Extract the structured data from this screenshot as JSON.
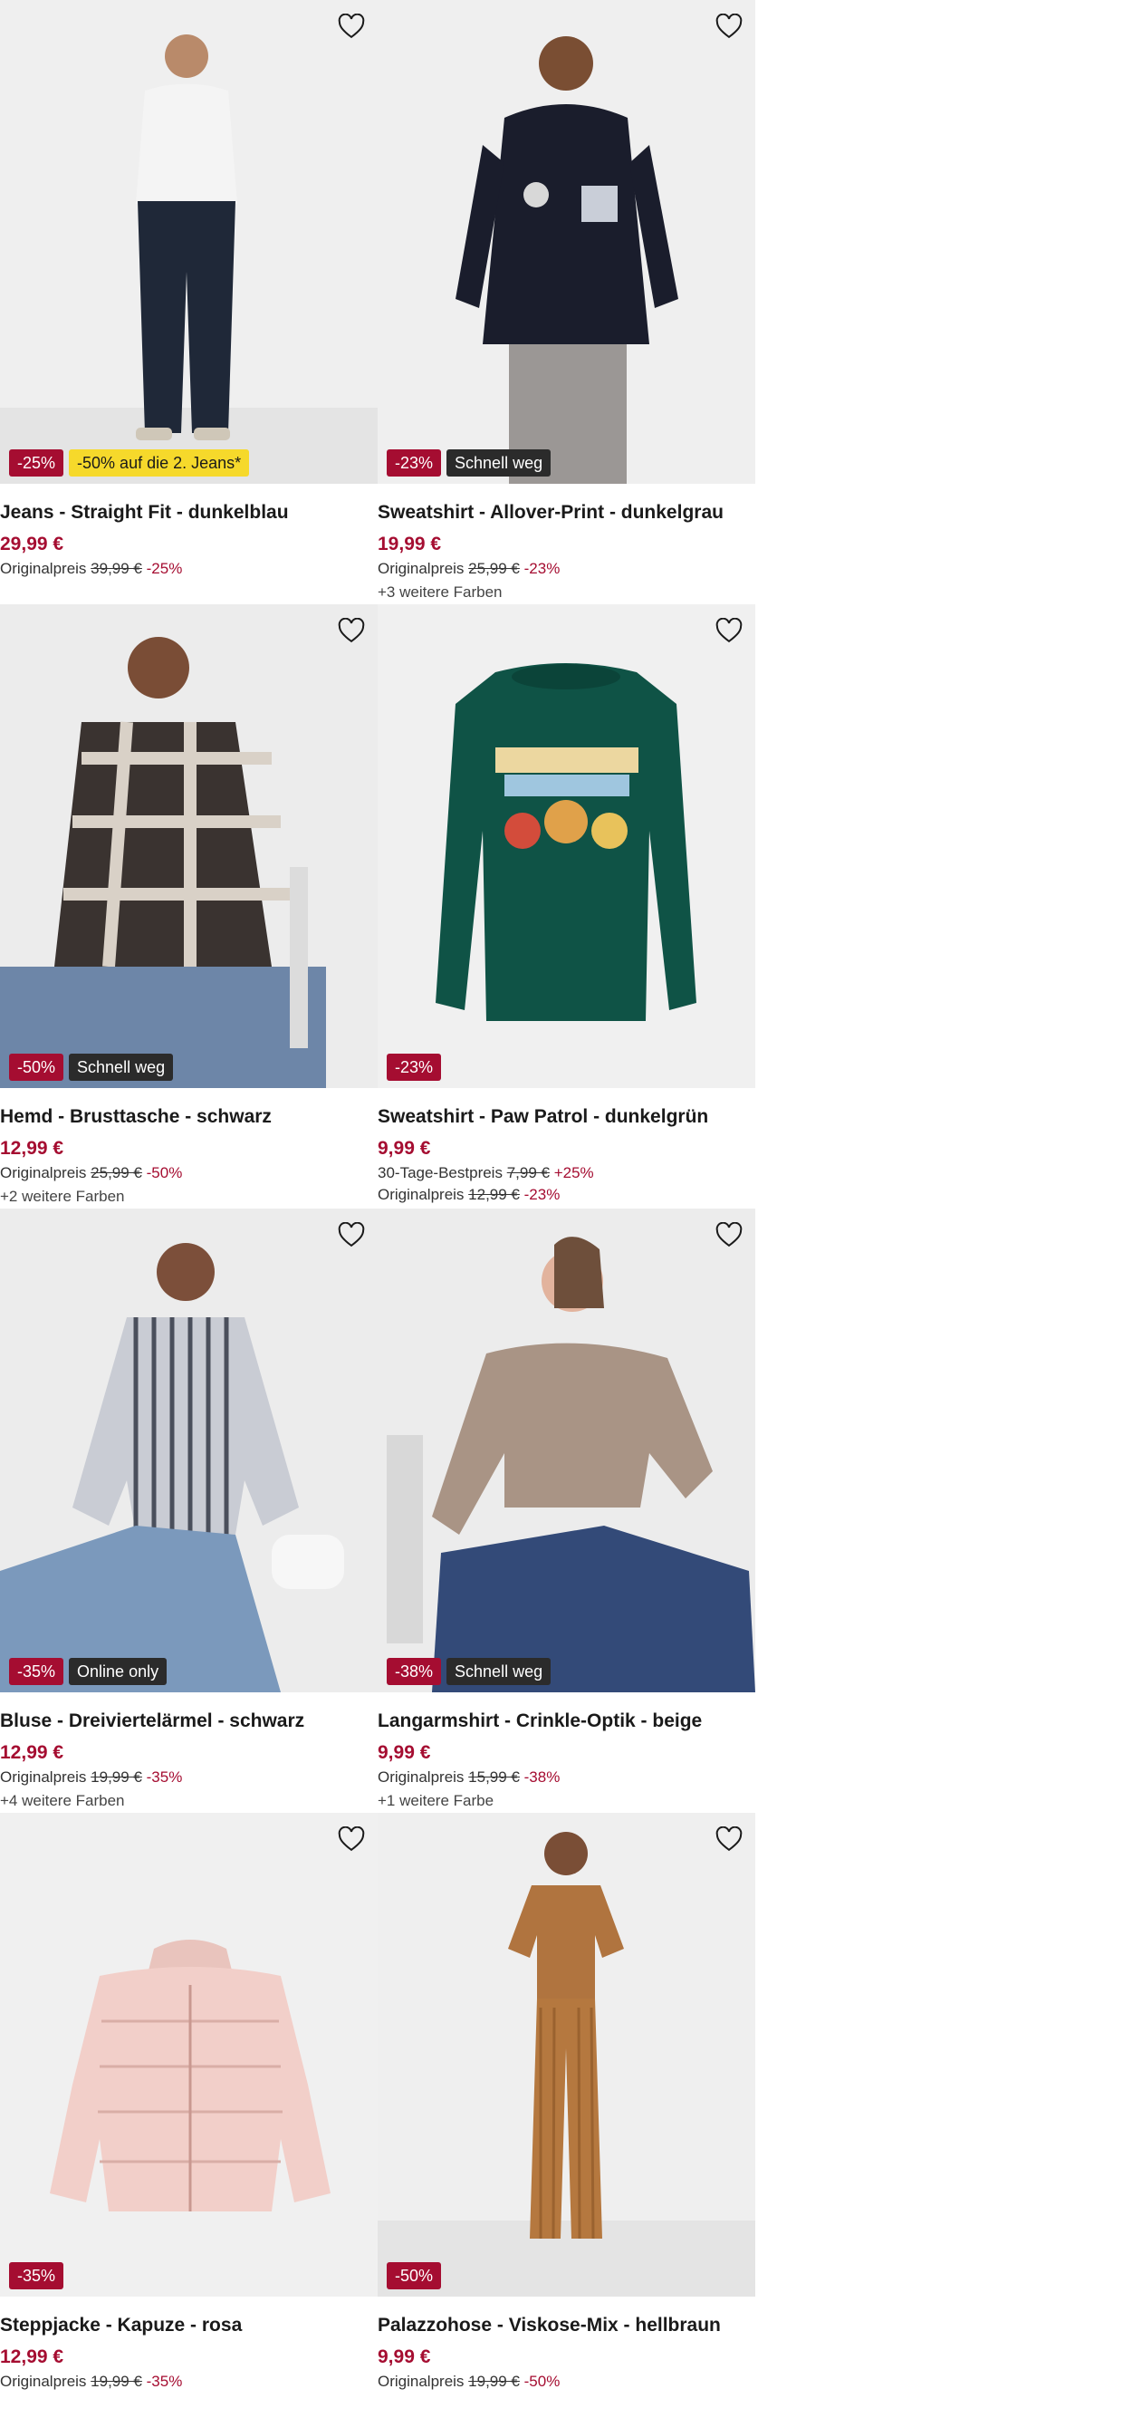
{
  "products": [
    {
      "name": "Jeans - Straight Fit - dunkelblau",
      "image_icon": "jeans-model-photo",
      "badges": [
        {
          "text": "-25%",
          "style": "sale"
        },
        {
          "text": "-50% auf die 2. Jeans*",
          "style": "yellow"
        }
      ],
      "price": "29,99 €",
      "best_price": null,
      "original": {
        "label": "Originalpreis",
        "value": "39,99 €",
        "pct": "-25%"
      },
      "more_colors": null
    },
    {
      "name": "Sweatshirt - Allover-Print - dunkelgrau",
      "image_icon": "hoodie-model-photo",
      "badges": [
        {
          "text": "-23%",
          "style": "sale"
        },
        {
          "text": "Schnell weg",
          "style": "dark"
        }
      ],
      "price": "19,99 €",
      "best_price": null,
      "original": {
        "label": "Originalpreis",
        "value": "25,99 €",
        "pct": "-23%"
      },
      "more_colors": "+3 weitere Farben"
    },
    {
      "name": "Hemd - Brusttasche - schwarz",
      "image_icon": "plaid-shirt-model-photo",
      "badges": [
        {
          "text": "-50%",
          "style": "sale"
        },
        {
          "text": "Schnell weg",
          "style": "dark"
        }
      ],
      "price": "12,99 €",
      "best_price": null,
      "original": {
        "label": "Originalpreis",
        "value": "25,99 €",
        "pct": "-50%"
      },
      "more_colors": "+2 weitere Farben"
    },
    {
      "name": "Sweatshirt - Paw Patrol - dunkelgrün",
      "image_icon": "paw-patrol-sweatshirt-photo",
      "badges": [
        {
          "text": "-23%",
          "style": "sale"
        }
      ],
      "price": "9,99 €",
      "best_price": {
        "label": "30-Tage-Bestpreis",
        "value": "7,99 €",
        "pct": "+25%"
      },
      "original": {
        "label": "Originalpreis",
        "value": "12,99 €",
        "pct": "-23%"
      },
      "more_colors": null
    },
    {
      "name": "Bluse - Dreiviertelärmel - schwarz",
      "image_icon": "striped-blouse-model-photo",
      "badges": [
        {
          "text": "-35%",
          "style": "sale"
        },
        {
          "text": "Online only",
          "style": "dark"
        }
      ],
      "price": "12,99 €",
      "best_price": null,
      "original": {
        "label": "Originalpreis",
        "value": "19,99 €",
        "pct": "-35%"
      },
      "more_colors": "+4 weitere Farben"
    },
    {
      "name": "Langarmshirt - Crinkle-Optik - beige",
      "image_icon": "crinkle-top-model-photo",
      "badges": [
        {
          "text": "-38%",
          "style": "sale"
        },
        {
          "text": "Schnell weg",
          "style": "dark"
        }
      ],
      "price": "9,99 €",
      "best_price": null,
      "original": {
        "label": "Originalpreis",
        "value": "15,99 €",
        "pct": "-38%"
      },
      "more_colors": "+1 weitere Farbe"
    },
    {
      "name": "Steppjacke - Kapuze - rosa",
      "image_icon": "puffer-jacket-photo",
      "badges": [
        {
          "text": "-35%",
          "style": "sale"
        }
      ],
      "price": "12,99 €",
      "best_price": null,
      "original": {
        "label": "Originalpreis",
        "value": "19,99 €",
        "pct": "-35%"
      },
      "more_colors": null
    },
    {
      "name": "Palazzohose - Viskose-Mix - hellbraun",
      "image_icon": "palazzo-pants-model-photo",
      "badges": [
        {
          "text": "-50%",
          "style": "sale"
        }
      ],
      "price": "9,99 €",
      "best_price": null,
      "original": {
        "label": "Originalpreis",
        "value": "19,99 €",
        "pct": "-50%"
      },
      "more_colors": null
    }
  ],
  "colors": {
    "sale": "#a50d31",
    "badge_dark": "#2b2b2b",
    "badge_yellow": "#f6d92b",
    "image_bg": "#f2f2f2"
  }
}
